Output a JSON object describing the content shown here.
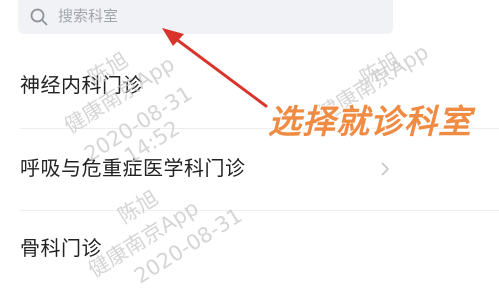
{
  "search": {
    "placeholder": "搜索科室"
  },
  "departments": [
    {
      "label": "神经内科门诊"
    },
    {
      "label": "呼吸与危重症医学科门诊"
    },
    {
      "label": "骨科门诊"
    }
  ],
  "watermark": {
    "name": "陈旭",
    "app": "健康南京App",
    "date": "2020-08-31",
    "time": "14:52"
  },
  "annotation": {
    "text": "选择就诊科室",
    "color": "#f08b43",
    "arrow_color": "#d9342b"
  },
  "icons": {
    "search": "search-icon",
    "chevron": "chevron-right-icon"
  }
}
